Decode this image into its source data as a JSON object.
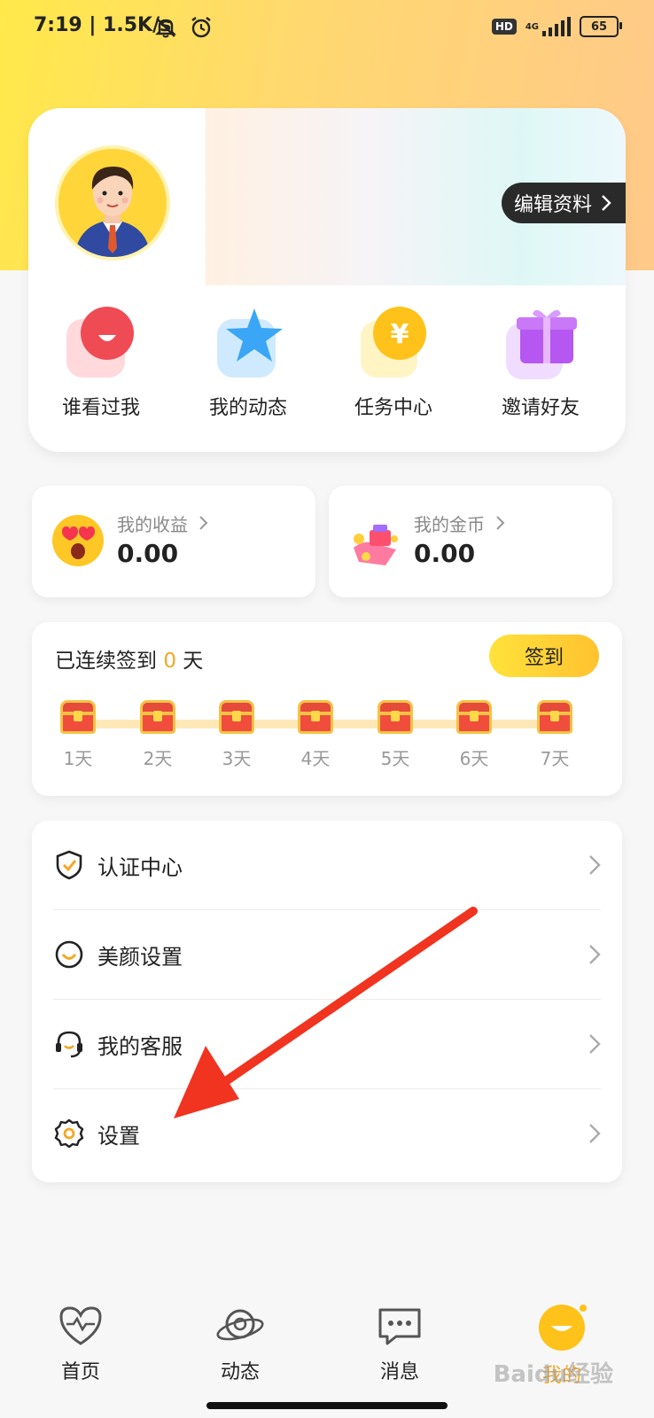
{
  "status_bar": {
    "time_speed": "7:19 | 1.5K/s",
    "hd_badge": "HD",
    "network": "4G",
    "battery": "65"
  },
  "profile": {
    "edit_label": "编辑资料"
  },
  "quick_actions": [
    {
      "label": "谁看过我",
      "icon": "visitor-icon"
    },
    {
      "label": "我的动态",
      "icon": "star-icon"
    },
    {
      "label": "任务中心",
      "icon": "coin-icon"
    },
    {
      "label": "邀请好友",
      "icon": "gift-icon"
    }
  ],
  "stats": {
    "earnings": {
      "title": "我的收益",
      "value": "0.00"
    },
    "coins": {
      "title": "我的金币",
      "value": "0.00"
    }
  },
  "checkin": {
    "prefix": "已连续签到",
    "count": "0",
    "suffix": "天",
    "button": "签到",
    "days": [
      "1天",
      "2天",
      "3天",
      "4天",
      "5天",
      "6天",
      "7天"
    ]
  },
  "menu": [
    {
      "label": "认证中心",
      "icon": "shield-check-icon"
    },
    {
      "label": "美颜设置",
      "icon": "smile-icon"
    },
    {
      "label": "我的客服",
      "icon": "headset-icon"
    },
    {
      "label": "设置",
      "icon": "gear-icon"
    }
  ],
  "tabs": [
    {
      "label": "首页",
      "icon": "heart-pulse-icon"
    },
    {
      "label": "动态",
      "icon": "planet-icon"
    },
    {
      "label": "消息",
      "icon": "chat-icon"
    },
    {
      "label": "我的",
      "icon": "smile-face-icon",
      "active": true
    }
  ],
  "watermark": "Baidu经验",
  "colors": {
    "accent": "#f5a623",
    "brand_yellow": "#ffd53a",
    "arrow_red": "#f0341f"
  }
}
